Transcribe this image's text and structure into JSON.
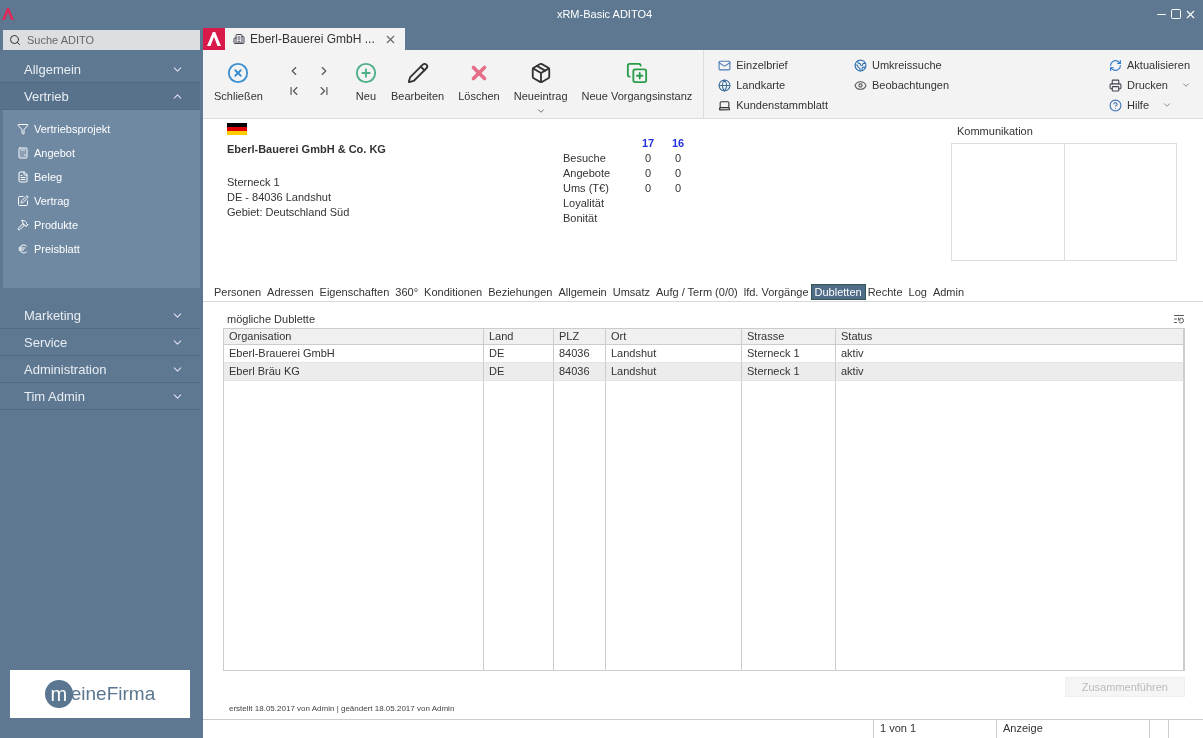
{
  "window": {
    "title": "xRM-Basic ADITO4"
  },
  "sidebar": {
    "search": {
      "placeholder": "Suche ADITO"
    },
    "sections": [
      {
        "label": "Allgemein",
        "expanded": false
      },
      {
        "label": "Vertrieb",
        "expanded": true,
        "children": [
          {
            "label": "Vertriebsprojekt"
          },
          {
            "label": "Angebot"
          },
          {
            "label": "Beleg"
          },
          {
            "label": "Vertrag"
          },
          {
            "label": "Produkte"
          },
          {
            "label": "Preisblatt"
          }
        ]
      },
      {
        "label": "Marketing",
        "expanded": false
      },
      {
        "label": "Service",
        "expanded": false
      },
      {
        "label": "Administration",
        "expanded": false
      },
      {
        "label": "Tim Admin",
        "expanded": false
      }
    ],
    "logo": {
      "initial": "m",
      "rest": "eineFirma"
    }
  },
  "tabs": [
    {
      "label": "Eberl-Bauerei GmbH ...",
      "selected": true
    }
  ],
  "toolbar": {
    "buttons": [
      {
        "kind": "close",
        "label": "Schließen",
        "dropdown": false
      },
      {
        "kind": "nav"
      },
      {
        "kind": "new",
        "label": "Neu",
        "dropdown": false
      },
      {
        "kind": "edit",
        "label": "Bearbeiten",
        "dropdown": false
      },
      {
        "kind": "delete",
        "label": "Löschen",
        "dropdown": false
      },
      {
        "kind": "entry",
        "label": "Neueintrag",
        "dropdown": true
      },
      {
        "kind": "instance",
        "label": "Neue Vorgangsinstanz",
        "dropdown": false
      }
    ],
    "link_columns": [
      [
        {
          "kind": "letter",
          "label": "Einzelbrief",
          "dropdown": false
        },
        {
          "kind": "map",
          "label": "Landkarte",
          "dropdown": false
        },
        {
          "kind": "sheet",
          "label": "Kundenstammblatt",
          "dropdown": false
        }
      ],
      [
        {
          "kind": "radius",
          "label": "Umkreissuche",
          "dropdown": false
        },
        {
          "kind": "watch",
          "label": "Beobachtungen",
          "dropdown": false
        }
      ]
    ],
    "right_links": [
      {
        "kind": "refresh",
        "label": "Aktualisieren",
        "dropdown": false
      },
      {
        "kind": "print",
        "label": "Drucken",
        "dropdown": true
      },
      {
        "kind": "help",
        "label": "Hilfe",
        "dropdown": true
      }
    ]
  },
  "company": {
    "name": "Eberl-Bauerei GmbH & Co. KG",
    "address": [
      "Sterneck 1",
      "DE - 84036 Landshut",
      "Gebiet: Deutschland Süd"
    ]
  },
  "stats": {
    "columns": [
      "17",
      "16"
    ],
    "rows": [
      {
        "label": "Besuche",
        "values": [
          "0",
          "0"
        ]
      },
      {
        "label": "Angebote",
        "values": [
          "0",
          "0"
        ]
      },
      {
        "label": "Ums (T€)",
        "values": [
          "0",
          "0"
        ]
      },
      {
        "label": "Loyalität"
      },
      {
        "label": "Bonität"
      }
    ]
  },
  "communication": {
    "title": "Kommunikation"
  },
  "detail_tabs": [
    {
      "label": "Personen",
      "selected": false
    },
    {
      "label": "Adressen",
      "selected": false
    },
    {
      "label": "Eigenschaften",
      "selected": false
    },
    {
      "label": "360°",
      "selected": false
    },
    {
      "label": "Konditionen",
      "selected": false
    },
    {
      "label": "Beziehungen",
      "selected": false
    },
    {
      "label": "Allgemein",
      "selected": false
    },
    {
      "label": "Umsatz",
      "selected": false
    },
    {
      "label": "Aufg / Term (0/0)",
      "selected": false
    },
    {
      "label": "lfd. Vorgänge",
      "selected": false
    },
    {
      "label": "Dubletten",
      "selected": true
    },
    {
      "label": "Rechte",
      "selected": false
    },
    {
      "label": "Log",
      "selected": false
    },
    {
      "label": "Admin",
      "selected": false
    }
  ],
  "table": {
    "title": "mögliche Dublette",
    "columns": [
      "Organisation",
      "Land",
      "PLZ",
      "Ort",
      "Strasse",
      "Status"
    ],
    "rows": [
      {
        "cells": [
          "Eberl-Brauerei GmbH",
          "DE",
          "84036",
          "Landshut",
          "Sterneck 1",
          "aktiv"
        ],
        "selected": false
      },
      {
        "cells": [
          "Eberl Bräu KG",
          "DE",
          "84036",
          "Landshut",
          "Sterneck 1",
          "aktiv"
        ],
        "selected": true
      }
    ]
  },
  "merge_button": {
    "label": "Zusammenführen",
    "disabled": true
  },
  "footer": "erstellt 18.05.2017 von Admin | geändert 18.05.2017 von Admin",
  "status_bar": [
    "1 von 1",
    "Anzeige"
  ]
}
